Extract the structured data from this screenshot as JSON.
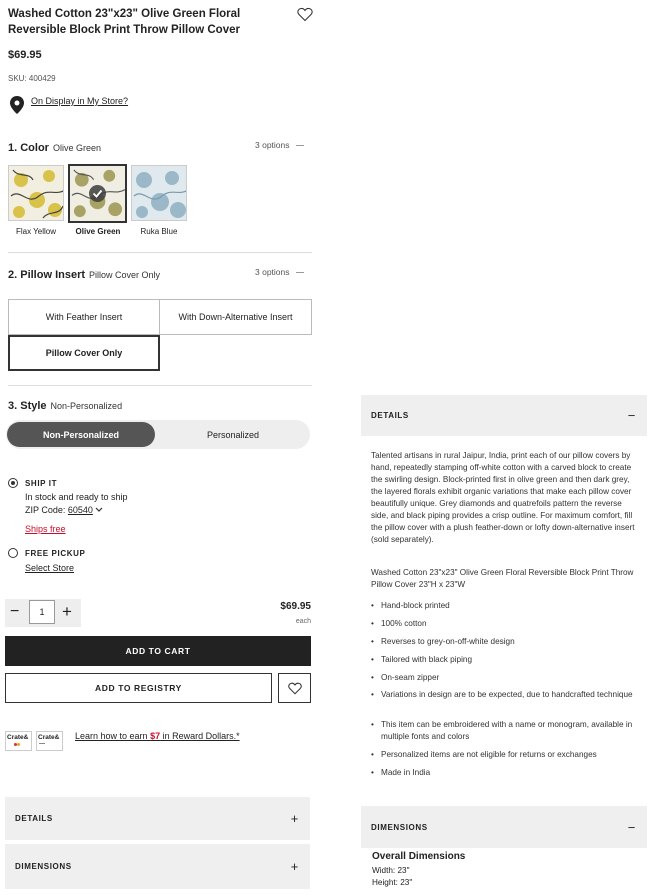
{
  "product": {
    "title": "Washed Cotton 23\"x23\" Olive Green Floral Reversible Block Print Throw Pillow Cover",
    "price": "$69.95",
    "sku": "SKU: 400429",
    "display_link": "On Display in My Store?"
  },
  "color": {
    "label": "1. Color",
    "value": "Olive Green",
    "options_count": "3 options",
    "swatches": [
      {
        "label": "Flax Yellow",
        "color": "#c9b660"
      },
      {
        "label": "Olive Green",
        "color": "#a9a06a"
      },
      {
        "label": "Ruka Blue",
        "color": "#9ab7c6"
      }
    ]
  },
  "insert": {
    "label": "2. Pillow Insert",
    "value": "Pillow Cover Only",
    "options_count": "3 options",
    "options": [
      "With Feather Insert",
      "With Down-Alternative Insert",
      "Pillow Cover Only"
    ]
  },
  "style": {
    "label": "3. Style",
    "value": "Non-Personalized",
    "options": [
      "Non-Personalized",
      "Personalized"
    ]
  },
  "fulfillment": {
    "ship_title": "SHIP IT",
    "ship_stock": "In stock and ready to ship",
    "zip_label": "ZIP Code:",
    "zip_value": "60540",
    "ships_free": "Ships free",
    "pickup_title": "FREE PICKUP",
    "select_store": "Select Store"
  },
  "purchase": {
    "qty": "1",
    "minus": "−",
    "plus": "+",
    "price": "$69.95",
    "each": "each",
    "add_to_cart": "ADD TO CART",
    "add_to_registry": "ADD TO REGISTRY"
  },
  "rewards": {
    "card_brand": "Crate&",
    "text_before": "Learn how to earn ",
    "amount": "$7",
    "text_after": " in Reward Dollars.*"
  },
  "accordions": {
    "details": "DETAILS",
    "dimensions": "DIMENSIONS",
    "plus": "+",
    "minus": "−"
  },
  "details_panel": {
    "paragraph": "Talented artisans in rural Jaipur, India, print each of our pillow covers by hand, repeatedly stamping off-white cotton with a carved block to create the swirling design. Block-printed first in olive green and then dark grey, the layered florals exhibit organic variations that make each pillow cover beautifully unique. Grey diamonds and quatrefoils pattern the reverse side, and black piping provides a crisp outline. For maximum comfort, fill the pillow cover with a plush feather-down or lofty down-alternative insert (sold separately).",
    "product_line": "Washed Cotton 23\"x23\" Olive Green Floral Reversible Block Print Throw Pillow Cover  23\"H x 23\"W",
    "bullets": [
      "Hand-block printed",
      "100% cotton",
      "Reverses to grey-on-off-white design",
      "Tailored with black piping",
      "On-seam zipper",
      "Variations in design are to be expected, due to handcrafted technique",
      "This item can be embroidered with a name or monogram, available in multiple fonts and colors",
      "Personalized items are not eligible for returns or exchanges",
      "Made in India"
    ]
  },
  "dimensions_panel": {
    "heading": "Overall Dimensions",
    "width": "Width: 23\"",
    "height": "Height: 23\""
  },
  "colors": {
    "accent_red": "#c8102e",
    "dark": "#222222",
    "panel_gray": "#efefef"
  }
}
